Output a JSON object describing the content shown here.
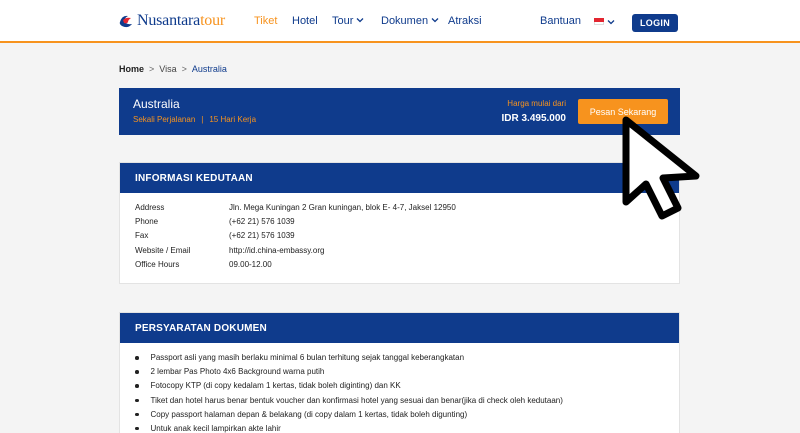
{
  "header": {
    "logo": {
      "primary": "Nusantara",
      "accent": "tour"
    },
    "nav": [
      {
        "label": "Tiket",
        "active": true,
        "dropdown": false
      },
      {
        "label": "Hotel",
        "active": false,
        "dropdown": false
      },
      {
        "label": "Tour",
        "active": false,
        "dropdown": true
      },
      {
        "label": "Dokumen",
        "active": false,
        "dropdown": true
      },
      {
        "label": "Atraksi",
        "active": false,
        "dropdown": false
      }
    ],
    "help": "Bantuan",
    "language_icon": "indonesia-flag-icon",
    "login_label": "LOGIN"
  },
  "breadcrumb": {
    "home": "Home",
    "separator": ">",
    "visa": "Visa",
    "current": "Australia"
  },
  "hero": {
    "title": "Australia",
    "trip": "Sekali Perjalanan",
    "separator": "|",
    "duration": "15 Hari Kerja",
    "price_label": "Harga mulai dari",
    "price": "IDR 3.495.000",
    "order_label": "Pesan Sekarang"
  },
  "embassy": {
    "heading": "INFORMASI KEDUTAAN",
    "rows": [
      {
        "key": "Address",
        "value": "Jln. Mega Kuningan 2 Gran kuningan, blok E- 4-7, Jaksel 12950"
      },
      {
        "key": "Phone",
        "value": "(+62 21) 576 1039"
      },
      {
        "key": "Fax",
        "value": "(+62 21) 576 1039"
      },
      {
        "key": "Website / Email",
        "value": "http://id.china-embassy.org"
      },
      {
        "key": "Office Hours",
        "value": "09.00-12.00"
      }
    ]
  },
  "documents": {
    "heading": "PERSYARATAN DOKUMEN",
    "items": [
      "Passport asli yang masih berlaku minimal 6 bulan terhitung sejak tanggal keberangkatan",
      "2 lembar Pas Photo 4x6 Background warna putih",
      "Fotocopy KTP (di copy kedalam 1 kertas, tidak boleh diginting) dan KK",
      "Tiket dan hotel harus benar bentuk voucher dan konfirmasi hotel yang sesuai dan benar(jika di check oleh kedutaan)",
      "Copy passport halaman depan & belakang (di copy dalam 1 kertas, tidak boleh digunting)",
      "Untuk anak kecil lampirkan akte lahir"
    ]
  },
  "colors": {
    "brand": "#0f3b8c",
    "accent": "#f7931e"
  },
  "cursor_icon": "mouse-pointer-icon"
}
